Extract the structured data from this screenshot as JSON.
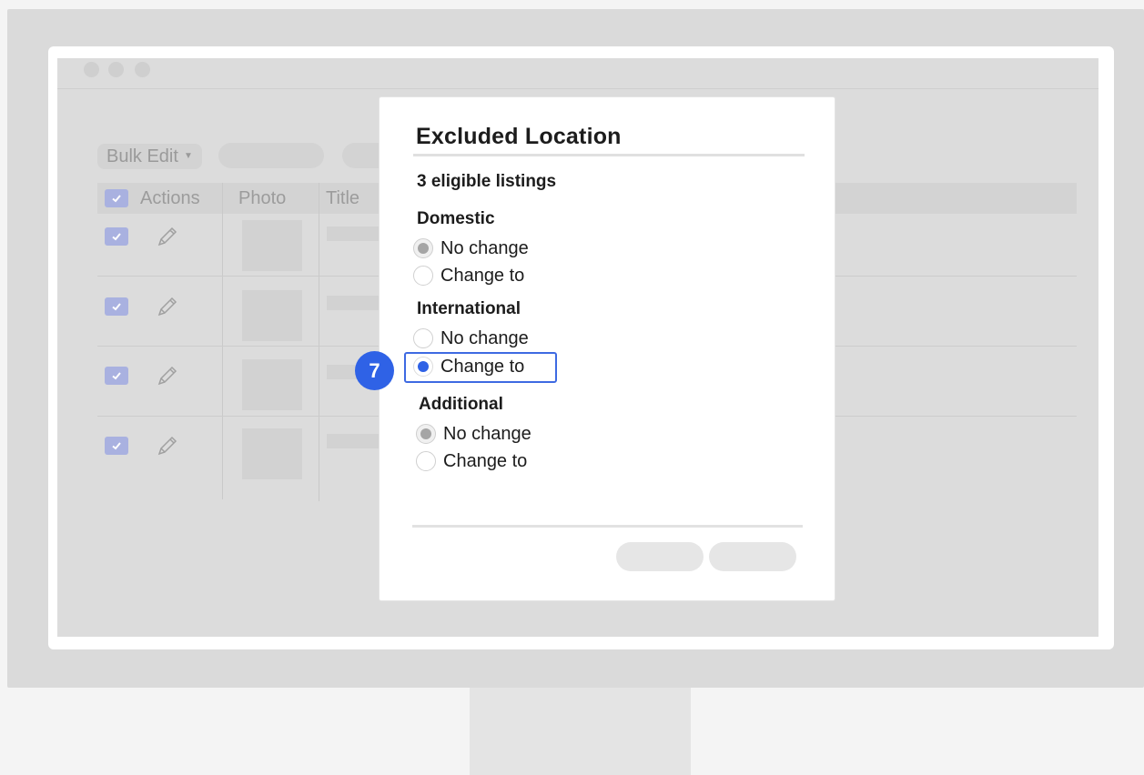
{
  "app": {
    "toolbar": {
      "bulk_edit_label": "Bulk Edit"
    },
    "table": {
      "headers": {
        "actions": "Actions",
        "photo": "Photo",
        "title": "Title"
      },
      "row_count": 4
    }
  },
  "modal": {
    "title": "Excluded Location",
    "eligible_text": "3 eligible listings",
    "sections": [
      {
        "label": "Domestic",
        "options": [
          {
            "label": "No change",
            "state": "selected-disabled"
          },
          {
            "label": "Change to",
            "state": "unselected"
          }
        ]
      },
      {
        "label": "International",
        "options": [
          {
            "label": "No change",
            "state": "unselected"
          },
          {
            "label": "Change to",
            "state": "selected"
          }
        ]
      },
      {
        "label": "Additional",
        "options": [
          {
            "label": "No change",
            "state": "selected-disabled"
          },
          {
            "label": "Change to",
            "state": "unselected"
          }
        ]
      }
    ]
  },
  "step_badge": "7",
  "colors": {
    "accent": "#2f62e6",
    "checkbox": "#a9b1e0",
    "overlay": "#dcdcdc"
  }
}
